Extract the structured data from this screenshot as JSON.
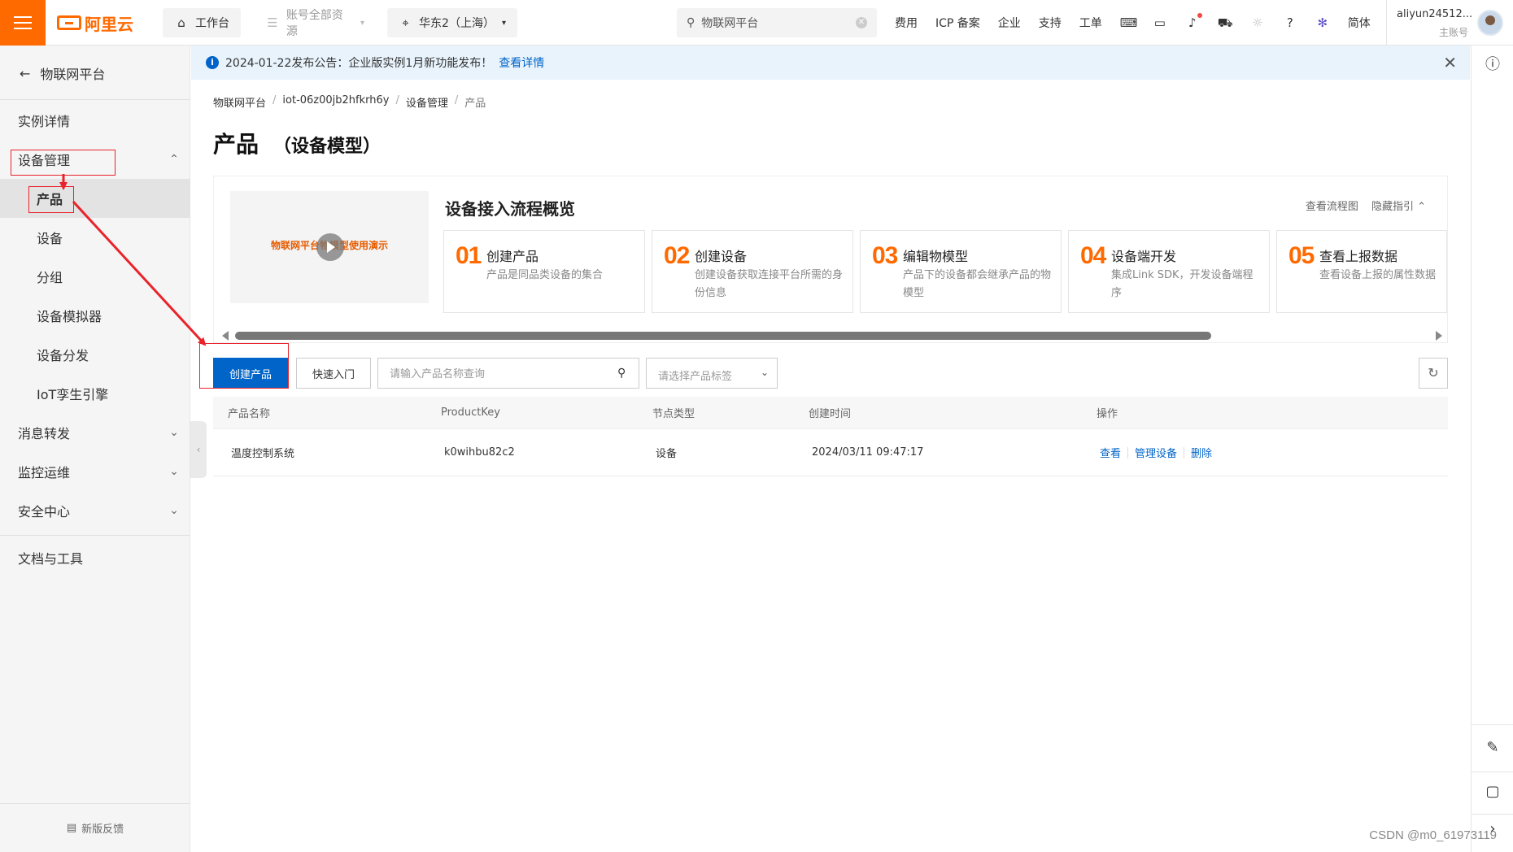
{
  "topbar": {
    "brand": "阿里云",
    "workbench": "工作台",
    "account_resources": "账号全部资源",
    "region": "华东2（上海）",
    "search_value": "物联网平台",
    "links": [
      "费用",
      "ICP 备案",
      "企业",
      "支持",
      "工单"
    ],
    "language": "简体",
    "user_name": "aliyun24512...",
    "user_sub": "主账号",
    "accent": "#ff6a00"
  },
  "sidebar": {
    "back_label": "物联网平台",
    "items": [
      {
        "label": "实例详情"
      },
      {
        "label": "设备管理"
      },
      {
        "label": "产品"
      },
      {
        "label": "设备"
      },
      {
        "label": "分组"
      },
      {
        "label": "设备模拟器"
      },
      {
        "label": "设备分发"
      },
      {
        "label": "IoT孪生引擎"
      },
      {
        "label": "消息转发"
      },
      {
        "label": "监控运维"
      },
      {
        "label": "安全中心"
      },
      {
        "label": "文档与工具"
      }
    ],
    "feedback": "新版反馈"
  },
  "notice": {
    "text": "2024-01-22发布公告：企业版实例1月新功能发布！",
    "link": "查看详情"
  },
  "breadcrumb": [
    "物联网平台",
    "iot-06z00jb2hfkrh6y",
    "设备管理",
    "产品"
  ],
  "page": {
    "title": "产品",
    "subtitle": "（设备模型）"
  },
  "guide": {
    "video_title": "物联网平台物模型使用演示",
    "title": "设备接入流程概览",
    "link_flowchart": "查看流程图",
    "link_hide": "隐藏指引",
    "steps": [
      {
        "num": "01",
        "title": "创建产品",
        "desc": "产品是同品类设备的集合"
      },
      {
        "num": "02",
        "title": "创建设备",
        "desc": "创建设备获取连接平台所需的身份信息"
      },
      {
        "num": "03",
        "title": "编辑物模型",
        "desc": "产品下的设备都会继承产品的物模型"
      },
      {
        "num": "04",
        "title": "设备端开发",
        "desc": "集成Link SDK，开发设备端程序"
      },
      {
        "num": "05",
        "title": "查看上报数据",
        "desc": "查看设备上报的属性数据"
      }
    ]
  },
  "toolbar": {
    "create_label": "创建产品",
    "quickstart_label": "快速入门",
    "search_placeholder": "请输入产品名称查询",
    "tag_placeholder": "请选择产品标签"
  },
  "table": {
    "columns": [
      "产品名称",
      "ProductKey",
      "节点类型",
      "创建时间",
      "操作"
    ],
    "rows": [
      {
        "name": "温度控制系统",
        "product_key": "k0wihbu82c2",
        "node_type": "设备",
        "created": "2024/03/11 09:47:17",
        "actions": [
          "查看",
          "管理设备",
          "删除"
        ]
      }
    ]
  },
  "watermark": "CSDN @m0_61973119",
  "colors": {
    "primary": "#0064c8",
    "annotation_red": "#e8232a"
  }
}
